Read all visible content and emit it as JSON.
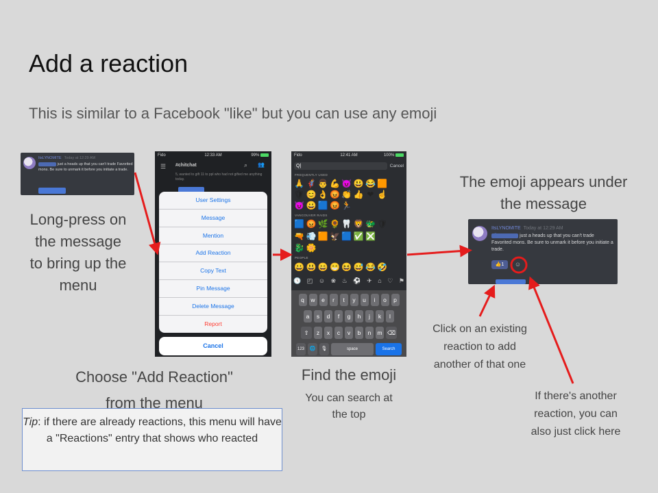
{
  "slide": {
    "title": "Add a reaction",
    "subtitle": "This is similar to a Facebook \"like\" but you can use any emoji"
  },
  "step1": {
    "caption_lines": [
      "Long-press on",
      "the message",
      "to bring up the",
      "menu"
    ],
    "card": {
      "username": "ItsLYNOMITE",
      "timestamp": "Today at 12:29 AM",
      "message": "just a heads up that you can't trade Favorited mons. Be sure to unmark it before you initiate a trade."
    }
  },
  "step2": {
    "status": {
      "carrier": "Fido",
      "time": "12:33 AM",
      "battery": "99%"
    },
    "channel": "chitchat",
    "preview_text": "5, wanted to gift 11 to ppl who had not gifted me anything today.",
    "menu_items": [
      "User Settings",
      "Message",
      "Mention",
      "Add Reaction",
      "Copy Text",
      "Pin Message",
      "Delete Message",
      "Report"
    ],
    "cancel_label": "Cancel",
    "caption_lines": [
      "Choose \"Add Reaction\"",
      "from the menu"
    ]
  },
  "tip": {
    "label": "Tip",
    "text": ": if there are already reactions, this menu will have a \"Reactions\" entry that shows who reacted"
  },
  "step3": {
    "status": {
      "carrier": "Fido",
      "time": "12:41 AM",
      "battery": "100%"
    },
    "search_value": "Q",
    "cancel_label": "Cancel",
    "sections": [
      "FREQUENTLY USED",
      "VANCOUVER RAIDS",
      "PEOPLE"
    ],
    "emoji_rows": [
      [
        "🙏",
        "🦸",
        "👨",
        "💪",
        "😈",
        "😃",
        "😂",
        "🟧"
      ],
      [
        "🛡",
        "😊",
        "👌",
        "😡",
        "👏",
        "👍",
        "❤",
        "☝"
      ],
      [
        "😈",
        "😀",
        "🟦",
        "😡",
        "🏃"
      ],
      [
        "🟦",
        "😡",
        "🌿",
        "🌻",
        "🦷",
        "🦁",
        "🐲",
        "🛡"
      ],
      [
        "🔫",
        "💨",
        "🟧",
        "🦅",
        "🟦",
        "✅",
        "❎"
      ],
      [
        "🐉",
        "🌼"
      ],
      [
        "😀",
        "😃",
        "😄",
        "😁",
        "😆",
        "😅",
        "😂",
        "🤣"
      ]
    ],
    "keyboard_rows": [
      [
        "q",
        "w",
        "e",
        "r",
        "t",
        "y",
        "u",
        "i",
        "o",
        "p"
      ],
      [
        "a",
        "s",
        "d",
        "f",
        "g",
        "h",
        "j",
        "k",
        "l"
      ],
      [
        "⇧",
        "z",
        "x",
        "c",
        "v",
        "b",
        "n",
        "m",
        "⌫"
      ]
    ],
    "bottom_keys": {
      "numbers": "123",
      "globe": "🌐",
      "mic": "🎙",
      "space": "space",
      "search": "Search"
    },
    "caption_title": "Find the emoji",
    "caption_sub_lines": [
      "You can search at",
      "the top"
    ]
  },
  "step4": {
    "heading_lines": [
      "The emoji appears under",
      "the message"
    ],
    "card": {
      "username": "ItsLYNOMITE",
      "timestamp": "Today at 12:29 AM",
      "message": "just a heads up that you can't trade Favorited mons. Be sure to unmark it before you initiate a trade.",
      "reaction_emoji": "👍",
      "reaction_count": "1",
      "add_reaction_icon": "add-reaction-icon"
    },
    "note_existing_lines": [
      "Click on an existing",
      "reaction to add",
      "another of that one"
    ],
    "note_another_lines": [
      "If there's another",
      "reaction, you can",
      "also just click here"
    ]
  },
  "colors": {
    "arrow": "#e51c1c",
    "discord_bg": "#36393f",
    "ios_blue": "#1a73e8",
    "tip_border": "#6d8ecf"
  }
}
